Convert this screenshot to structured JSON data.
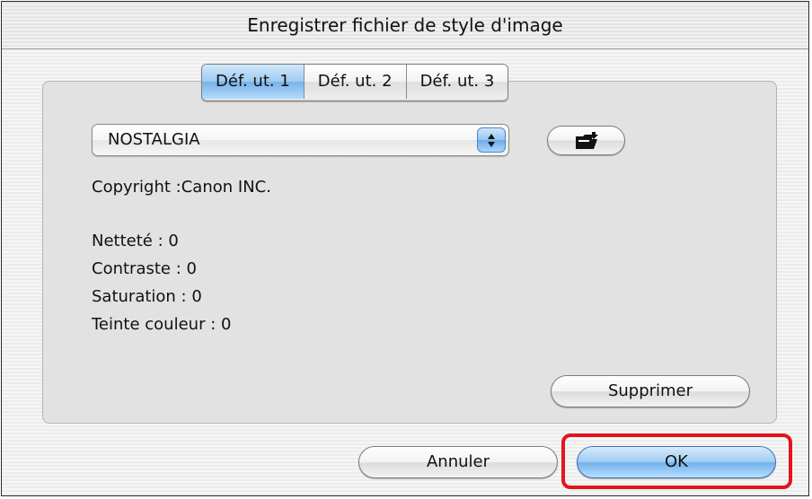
{
  "dialog": {
    "title": "Enregistrer fichier de style d'image"
  },
  "tabs": [
    {
      "label": "Déf. ut. 1",
      "selected": true
    },
    {
      "label": "Déf. ut. 2",
      "selected": false
    },
    {
      "label": "Déf. ut. 3",
      "selected": false
    }
  ],
  "style_select": {
    "value": "NOSTALGIA"
  },
  "info": {
    "copyright": "Copyright :Canon INC.",
    "sharpness": "Netteté : 0",
    "contrast": "Contraste : 0",
    "saturation": "Saturation : 0",
    "color_tone": "Teinte couleur : 0"
  },
  "buttons": {
    "open_folder_icon": "open-folder-icon",
    "delete": "Supprimer",
    "cancel": "Annuler",
    "ok": "OK"
  },
  "colors": {
    "selected_tab": "#8fc2f0",
    "default_button": "#8fc2f0",
    "highlight_frame": "#e4141f"
  }
}
